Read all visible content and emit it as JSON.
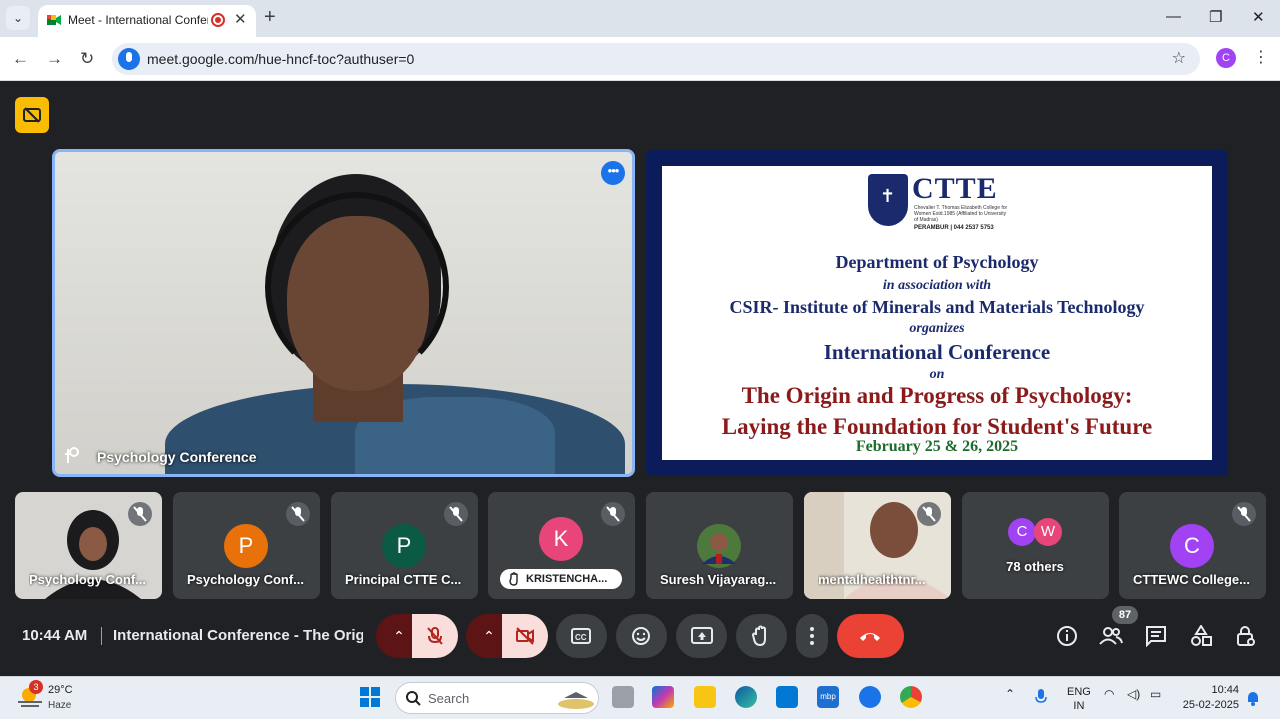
{
  "browser": {
    "tab_title": "Meet - International Conference",
    "url": "meet.google.com/hue-hncf-toc?authuser=0",
    "profile_initial": "C"
  },
  "main_tile": {
    "name": "Psychology Conference"
  },
  "slide": {
    "logo_text": "CTTE",
    "logo_sub": "Chevalier T. Thomas Elizabeth College for Women Estd.1985 (Affiliated to University of Madras)",
    "logo_loc": "PERAMBUR | 044 2537 5753",
    "dept": "Department of Psychology",
    "assoc": "in association with",
    "csir": "CSIR- Institute of Minerals and Materials Technology",
    "organizes": "organizes",
    "conf": "International Conference",
    "on": "on",
    "title1": "The Origin and Progress of Psychology:",
    "title2": "Laying the Foundation for Student's Future",
    "date": "February 25 & 26, 2025"
  },
  "participants": [
    {
      "name": "Psychology Conf...",
      "type": "photo"
    },
    {
      "name": "Psychology Conf...",
      "initial": "P",
      "color": "#e8710a"
    },
    {
      "name": "Principal CTTE C...",
      "initial": "P",
      "color": "#0b5a45"
    },
    {
      "name": "KRISTENCHA...",
      "initial": "K",
      "color": "#e8457a"
    },
    {
      "name": "Suresh Vijayarag...",
      "type": "avatar-photo"
    },
    {
      "name": "mentalhealthtnr...",
      "type": "photo"
    },
    {
      "name": "78 others",
      "initials": [
        "C",
        "W"
      ],
      "colors": [
        "#a142f4",
        "#e8457a"
      ]
    },
    {
      "name": "CTTEWC College...",
      "initial": "C",
      "color": "#a142f4"
    }
  ],
  "controls": {
    "time": "10:44 AM",
    "meeting_title": "International Conference - The Origin and Progress of Psychology",
    "people_count": "87"
  },
  "taskbar": {
    "weather_badge": "3",
    "temp": "29°C",
    "weather": "Haze",
    "search": "Search",
    "lang1": "ENG",
    "lang2": "IN",
    "time": "10:44",
    "date": "25-02-2025"
  },
  "colors": {
    "meet_bg": "#202124",
    "tile_bg": "#3c4043",
    "leave_red": "#ea4335",
    "accent_blue": "#8ab4f8",
    "slide_navy": "#0c1c5b",
    "slide_maroon": "#8b1a1a"
  }
}
